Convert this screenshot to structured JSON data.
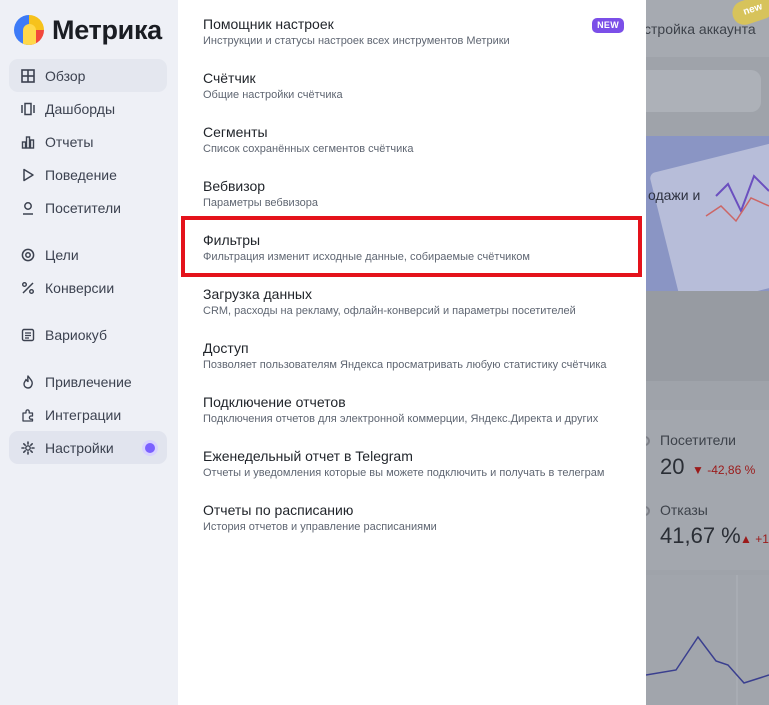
{
  "app": {
    "logo_text": "Метрика"
  },
  "sidebar": {
    "items": [
      {
        "label": "Обзор",
        "icon": "grid-icon",
        "state": "active"
      },
      {
        "label": "Дашборды",
        "icon": "dashboards-icon"
      },
      {
        "label": "Отчеты",
        "icon": "bar-chart-icon"
      },
      {
        "label": "Поведение",
        "icon": "play-icon"
      },
      {
        "label": "Посетители",
        "icon": "user-icon"
      },
      {
        "label": "Цели",
        "icon": "target-icon"
      },
      {
        "label": "Конверсии",
        "icon": "percent-icon"
      },
      {
        "label": "Вариокуб",
        "icon": "variocube-icon"
      },
      {
        "label": "Привлечение",
        "icon": "flame-icon"
      },
      {
        "label": "Интеграции",
        "icon": "puzzle-icon"
      },
      {
        "label": "Настройки",
        "icon": "gear-icon",
        "state": "selected",
        "has_indicator": true
      }
    ]
  },
  "settings_menu": {
    "items": [
      {
        "title": "Помощник настроек",
        "description": "Инструкции и статусы настроек всех инструментов Метрики",
        "badge": "NEW"
      },
      {
        "title": "Счётчик",
        "description": "Общие настройки счётчика"
      },
      {
        "title": "Сегменты",
        "description": "Список сохранённых сегментов счётчика"
      },
      {
        "title": "Вебвизор",
        "description": "Параметры вебвизора"
      },
      {
        "title": "Фильтры",
        "description": "Фильтрация изменит исходные данные, собираемые счётчиком",
        "highlighted": true
      },
      {
        "title": "Загрузка данных",
        "description": "CRM, расходы на рекламу, офлайн-конверсий и параметры посетителей"
      },
      {
        "title": "Доступ",
        "description": "Позволяет пользователям Яндекса просматривать любую статистику счётчика"
      },
      {
        "title": "Подключение отчетов",
        "description": "Подключения отчетов для электронной коммерции, Яндекс.Директа и других"
      },
      {
        "title": "Еженедельный отчет в Telegram",
        "description": "Отчеты и уведомления которые вы можете подключить и получать в телеграм"
      },
      {
        "title": "Отчеты по расписанию",
        "description": "История отчетов и управление расписаниями"
      }
    ]
  },
  "background": {
    "header_fragment": "стройка аккаунта",
    "banner_fragment": "одажи и",
    "banner_badge": "new",
    "stats": [
      {
        "label": "Посетители",
        "value": "20",
        "delta": "▼ -42,86 %"
      },
      {
        "label": "Отказы",
        "value": "41,67 %",
        "delta": "▲ +1"
      }
    ]
  },
  "colors": {
    "accent_purple": "#7b4fe8",
    "highlight_red": "#e4121b",
    "sidebar_bg": "#eef0f6"
  }
}
